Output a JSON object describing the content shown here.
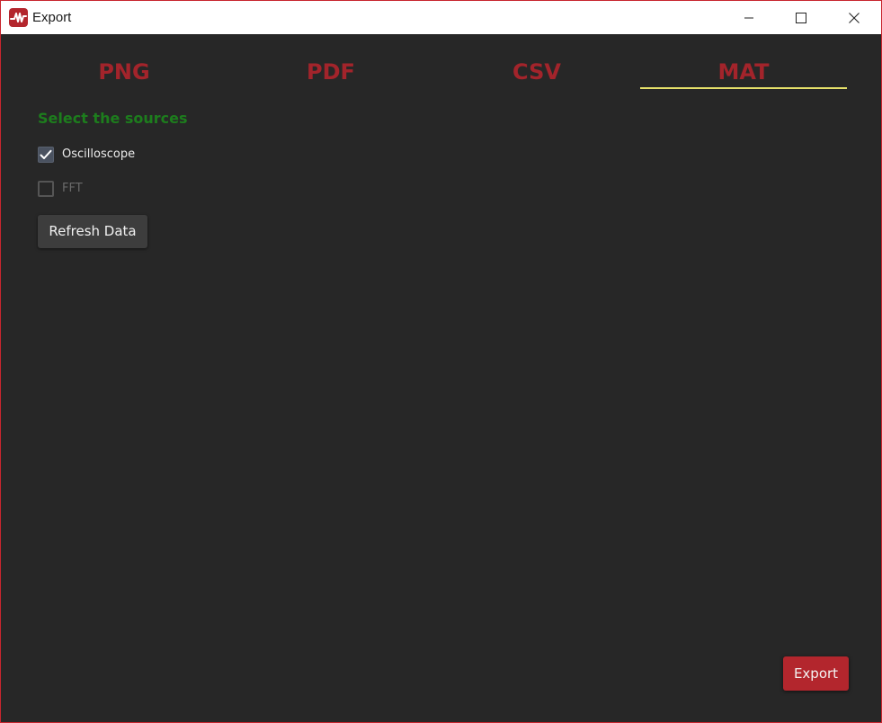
{
  "window": {
    "title": "Export",
    "app_icon": "oscilloscope-app-icon",
    "controls": {
      "minimize_icon": "minimize-icon",
      "maximize_icon": "maximize-icon",
      "close_icon": "close-icon"
    }
  },
  "tabs": [
    {
      "label": "PNG",
      "selected": false
    },
    {
      "label": "PDF",
      "selected": false
    },
    {
      "label": "CSV",
      "selected": false
    },
    {
      "label": "MAT",
      "selected": true
    }
  ],
  "sources": {
    "title": "Select the sources",
    "items": [
      {
        "label": "Oscilloscope",
        "checked": true,
        "enabled": true
      },
      {
        "label": "FFT",
        "checked": false,
        "enabled": false
      }
    ],
    "refresh_label": "Refresh Data"
  },
  "footer": {
    "export_label": "Export"
  },
  "colors": {
    "accent": "#b3262d",
    "tab_text": "#a3242b",
    "tab_underline": "#e6e06a",
    "section_title": "#1d7d1d",
    "background": "#272727"
  }
}
